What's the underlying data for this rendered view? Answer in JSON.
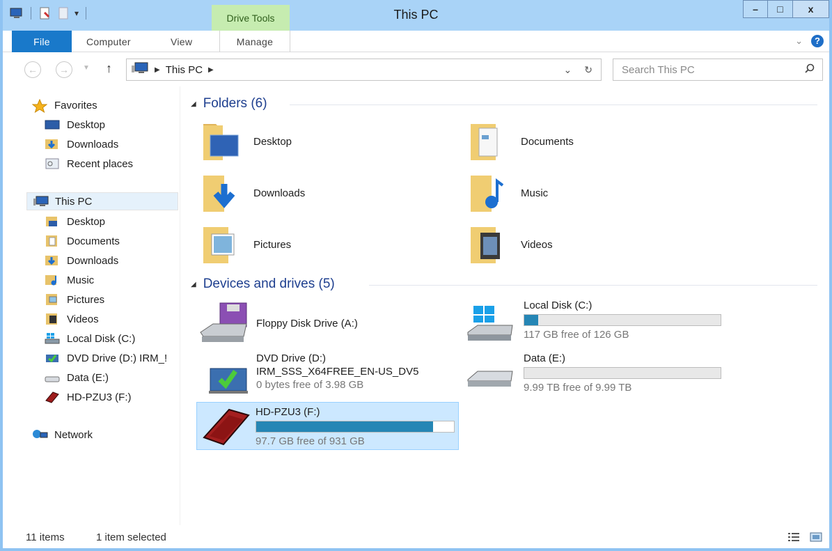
{
  "window": {
    "title": "This PC",
    "contextual_tab": "Drive Tools",
    "buttons": {
      "minimize": "–",
      "maximize": "□",
      "close": "x"
    }
  },
  "ribbon": {
    "tabs": [
      {
        "label": "File"
      },
      {
        "label": "Computer"
      },
      {
        "label": "View"
      },
      {
        "label": "Manage"
      }
    ],
    "help_label": "?"
  },
  "navigation": {
    "breadcrumb": [
      "This PC"
    ],
    "search_placeholder": "Search This PC"
  },
  "sidebar": {
    "favorites": {
      "label": "Favorites",
      "items": [
        "Desktop",
        "Downloads",
        "Recent places"
      ]
    },
    "this_pc": {
      "label": "This PC",
      "items": [
        "Desktop",
        "Documents",
        "Downloads",
        "Music",
        "Pictures",
        "Videos",
        "Local Disk (C:)",
        "DVD Drive (D:) IRM_!",
        "Data (E:)",
        "HD-PZU3 (F:)"
      ]
    },
    "network": {
      "label": "Network"
    }
  },
  "folders": {
    "header": "Folders (6)",
    "items": [
      "Desktop",
      "Documents",
      "Downloads",
      "Music",
      "Pictures",
      "Videos"
    ]
  },
  "devices": {
    "header": "Devices and drives (5)",
    "items": [
      {
        "name": "Floppy Disk Drive (A:)",
        "type": "floppy-drive-icon"
      },
      {
        "name": "Local Disk (C:)",
        "free": "117 GB free of 126 GB",
        "used_fraction": 0.071,
        "type": "windows-drive-icon"
      },
      {
        "name": "DVD Drive (D:)",
        "volume": "IRM_SSS_X64FREE_EN-US_DV5",
        "free": "0 bytes free of 3.98 GB",
        "type": "dvd-drive-icon"
      },
      {
        "name": "Data (E:)",
        "free": "9.99 TB free of 9.99 TB",
        "used_fraction": 0.0,
        "type": "hard-drive-icon"
      },
      {
        "name": "HD-PZU3 (F:)",
        "free": "97.7 GB free of 931 GB",
        "used_fraction": 0.895,
        "type": "external-drive-icon",
        "selected": true
      }
    ]
  },
  "status_bar": {
    "item_count": "11 items",
    "selection": "1 item selected"
  },
  "colors": {
    "title_bar": "#a9d3f7",
    "file_tab": "#1979ca",
    "contextual_tab": "#c6ecb0",
    "capacity_bar": "#2586b5",
    "selection": "#cce8ff",
    "group_header": "#1e3f8f"
  }
}
